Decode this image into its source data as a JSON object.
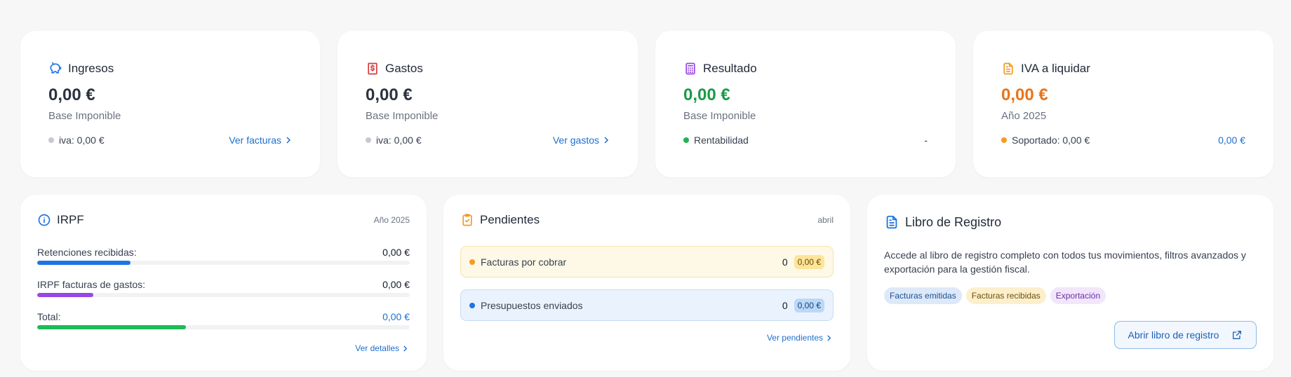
{
  "stats": [
    {
      "title": "Ingresos",
      "icon": "piggy-bank-icon",
      "value": "0,00 €",
      "value_color": "#2b3340",
      "sub": "Base Imponible",
      "footer_left": "iva: 0,00 €",
      "dot_color": "#c7c9cc",
      "footer_right": "Ver facturas"
    },
    {
      "title": "Gastos",
      "icon": "receipt-dollar-icon",
      "value": "0,00 €",
      "value_color": "#2b3340",
      "sub": "Base Imponible",
      "footer_left": "iva: 0,00 €",
      "dot_color": "#c7c9cc",
      "footer_right": "Ver gastos"
    },
    {
      "title": "Resultado",
      "icon": "calculator-icon",
      "value": "0,00 €",
      "value_color": "#1a9a47",
      "sub": "Base Imponible",
      "footer_left": "Rentabilidad",
      "dot_color": "#22b155",
      "footer_right": "-"
    },
    {
      "title": "IVA a liquidar",
      "icon": "document-icon",
      "value": "0,00 €",
      "value_color": "#e8751a",
      "sub": "Año 2025",
      "footer_left": "Soportado: 0,00 €",
      "dot_color": "#f59a23",
      "footer_right": "0,00 €"
    }
  ],
  "irpf": {
    "title": "IRPF",
    "year": "Año 2025",
    "rows": [
      {
        "label": "Retenciones recibidas:",
        "value": "0,00 €",
        "fill": 0.25,
        "color": "#1d74e5"
      },
      {
        "label": "IRPF facturas de gastos:",
        "value": "0,00 €",
        "fill": 0.15,
        "color": "#9747e6"
      },
      {
        "label": "Total:",
        "value": "0,00 €",
        "fill": 0.4,
        "color": "#1fba5a"
      }
    ],
    "link": "Ver detalles"
  },
  "pendientes": {
    "title": "Pendientes",
    "month": "abril",
    "items": [
      {
        "label": "Facturas por cobrar",
        "count": "0",
        "amount": "0,00 €"
      },
      {
        "label": "Presupuestos enviados",
        "count": "0",
        "amount": "0,00 €"
      }
    ],
    "link": "Ver pendientes"
  },
  "libro": {
    "title": "Libro de Registro",
    "description": "Accede al libro de registro completo con todos tus movimientos, filtros avanzados y exportación para la gestión fiscal.",
    "tags": [
      "Facturas emitidas",
      "Facturas recibidas",
      "Exportación"
    ],
    "button": "Abrir libro de registro"
  },
  "colors": {
    "link": "#1d6fd1",
    "accent_orange": "#f59a23",
    "accent_blue": "#1d74e5"
  }
}
